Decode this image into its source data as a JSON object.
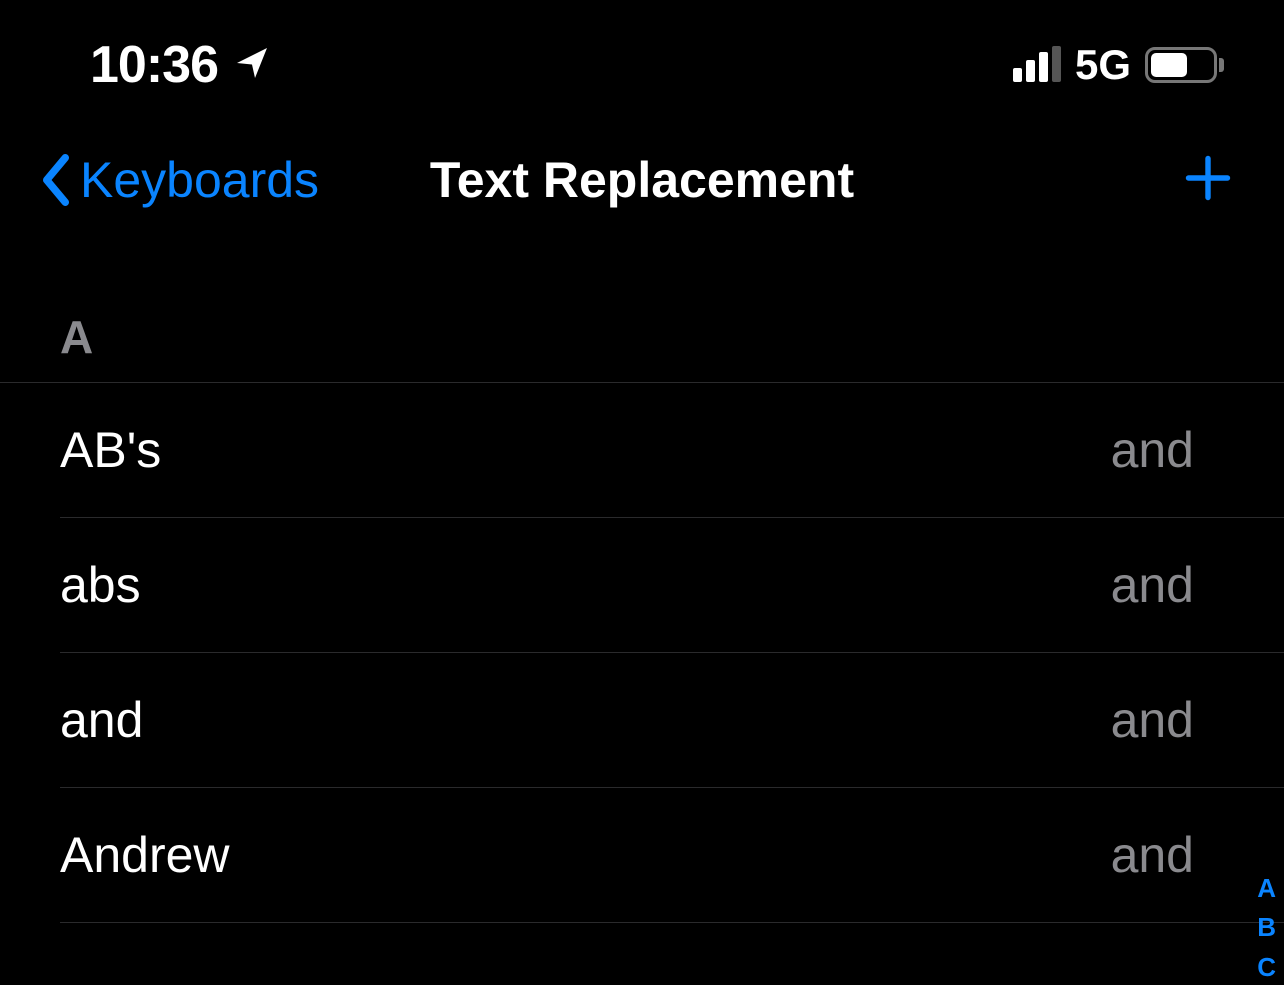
{
  "status_bar": {
    "time": "10:36",
    "network": "5G"
  },
  "nav": {
    "back_label": "Keyboards",
    "title": "Text Replacement"
  },
  "section": {
    "header": "A",
    "rows": [
      {
        "phrase": "AB's",
        "shortcut": "and"
      },
      {
        "phrase": "abs",
        "shortcut": "and"
      },
      {
        "phrase": "and",
        "shortcut": "and"
      },
      {
        "phrase": "Andrew",
        "shortcut": "and"
      }
    ]
  },
  "index_bar": [
    "A",
    "B",
    "C"
  ]
}
